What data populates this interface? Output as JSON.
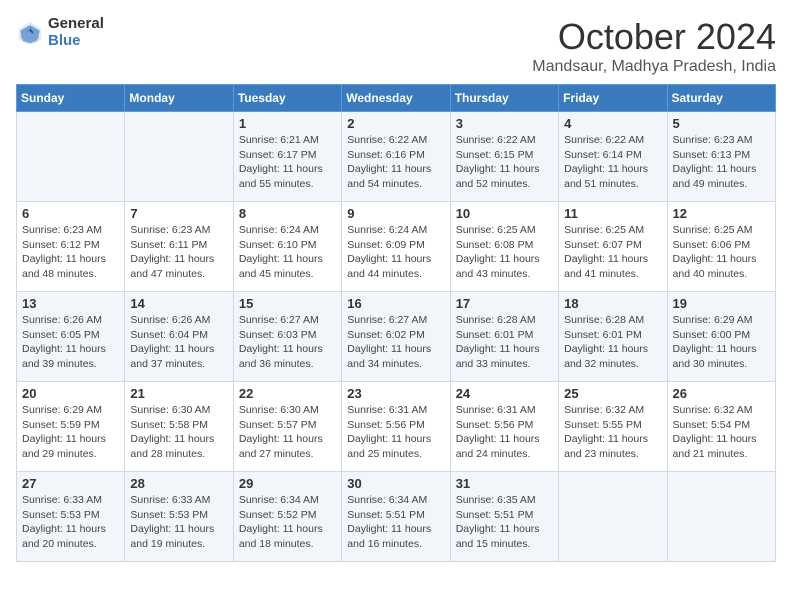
{
  "logo": {
    "general": "General",
    "blue": "Blue"
  },
  "header": {
    "month": "October 2024",
    "location": "Mandsaur, Madhya Pradesh, India"
  },
  "weekdays": [
    "Sunday",
    "Monday",
    "Tuesday",
    "Wednesday",
    "Thursday",
    "Friday",
    "Saturday"
  ],
  "weeks": [
    [
      {
        "day": "",
        "info": ""
      },
      {
        "day": "",
        "info": ""
      },
      {
        "day": "1",
        "info": "Sunrise: 6:21 AM\nSunset: 6:17 PM\nDaylight: 11 hours and 55 minutes."
      },
      {
        "day": "2",
        "info": "Sunrise: 6:22 AM\nSunset: 6:16 PM\nDaylight: 11 hours and 54 minutes."
      },
      {
        "day": "3",
        "info": "Sunrise: 6:22 AM\nSunset: 6:15 PM\nDaylight: 11 hours and 52 minutes."
      },
      {
        "day": "4",
        "info": "Sunrise: 6:22 AM\nSunset: 6:14 PM\nDaylight: 11 hours and 51 minutes."
      },
      {
        "day": "5",
        "info": "Sunrise: 6:23 AM\nSunset: 6:13 PM\nDaylight: 11 hours and 49 minutes."
      }
    ],
    [
      {
        "day": "6",
        "info": "Sunrise: 6:23 AM\nSunset: 6:12 PM\nDaylight: 11 hours and 48 minutes."
      },
      {
        "day": "7",
        "info": "Sunrise: 6:23 AM\nSunset: 6:11 PM\nDaylight: 11 hours and 47 minutes."
      },
      {
        "day": "8",
        "info": "Sunrise: 6:24 AM\nSunset: 6:10 PM\nDaylight: 11 hours and 45 minutes."
      },
      {
        "day": "9",
        "info": "Sunrise: 6:24 AM\nSunset: 6:09 PM\nDaylight: 11 hours and 44 minutes."
      },
      {
        "day": "10",
        "info": "Sunrise: 6:25 AM\nSunset: 6:08 PM\nDaylight: 11 hours and 43 minutes."
      },
      {
        "day": "11",
        "info": "Sunrise: 6:25 AM\nSunset: 6:07 PM\nDaylight: 11 hours and 41 minutes."
      },
      {
        "day": "12",
        "info": "Sunrise: 6:25 AM\nSunset: 6:06 PM\nDaylight: 11 hours and 40 minutes."
      }
    ],
    [
      {
        "day": "13",
        "info": "Sunrise: 6:26 AM\nSunset: 6:05 PM\nDaylight: 11 hours and 39 minutes."
      },
      {
        "day": "14",
        "info": "Sunrise: 6:26 AM\nSunset: 6:04 PM\nDaylight: 11 hours and 37 minutes."
      },
      {
        "day": "15",
        "info": "Sunrise: 6:27 AM\nSunset: 6:03 PM\nDaylight: 11 hours and 36 minutes."
      },
      {
        "day": "16",
        "info": "Sunrise: 6:27 AM\nSunset: 6:02 PM\nDaylight: 11 hours and 34 minutes."
      },
      {
        "day": "17",
        "info": "Sunrise: 6:28 AM\nSunset: 6:01 PM\nDaylight: 11 hours and 33 minutes."
      },
      {
        "day": "18",
        "info": "Sunrise: 6:28 AM\nSunset: 6:01 PM\nDaylight: 11 hours and 32 minutes."
      },
      {
        "day": "19",
        "info": "Sunrise: 6:29 AM\nSunset: 6:00 PM\nDaylight: 11 hours and 30 minutes."
      }
    ],
    [
      {
        "day": "20",
        "info": "Sunrise: 6:29 AM\nSunset: 5:59 PM\nDaylight: 11 hours and 29 minutes."
      },
      {
        "day": "21",
        "info": "Sunrise: 6:30 AM\nSunset: 5:58 PM\nDaylight: 11 hours and 28 minutes."
      },
      {
        "day": "22",
        "info": "Sunrise: 6:30 AM\nSunset: 5:57 PM\nDaylight: 11 hours and 27 minutes."
      },
      {
        "day": "23",
        "info": "Sunrise: 6:31 AM\nSunset: 5:56 PM\nDaylight: 11 hours and 25 minutes."
      },
      {
        "day": "24",
        "info": "Sunrise: 6:31 AM\nSunset: 5:56 PM\nDaylight: 11 hours and 24 minutes."
      },
      {
        "day": "25",
        "info": "Sunrise: 6:32 AM\nSunset: 5:55 PM\nDaylight: 11 hours and 23 minutes."
      },
      {
        "day": "26",
        "info": "Sunrise: 6:32 AM\nSunset: 5:54 PM\nDaylight: 11 hours and 21 minutes."
      }
    ],
    [
      {
        "day": "27",
        "info": "Sunrise: 6:33 AM\nSunset: 5:53 PM\nDaylight: 11 hours and 20 minutes."
      },
      {
        "day": "28",
        "info": "Sunrise: 6:33 AM\nSunset: 5:53 PM\nDaylight: 11 hours and 19 minutes."
      },
      {
        "day": "29",
        "info": "Sunrise: 6:34 AM\nSunset: 5:52 PM\nDaylight: 11 hours and 18 minutes."
      },
      {
        "day": "30",
        "info": "Sunrise: 6:34 AM\nSunset: 5:51 PM\nDaylight: 11 hours and 16 minutes."
      },
      {
        "day": "31",
        "info": "Sunrise: 6:35 AM\nSunset: 5:51 PM\nDaylight: 11 hours and 15 minutes."
      },
      {
        "day": "",
        "info": ""
      },
      {
        "day": "",
        "info": ""
      }
    ]
  ]
}
